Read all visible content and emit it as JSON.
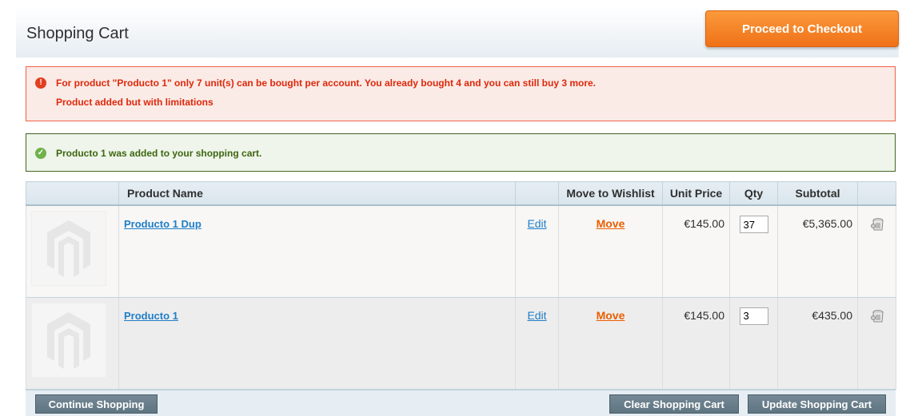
{
  "header": {
    "title": "Shopping Cart",
    "checkout_label": "Proceed to Checkout"
  },
  "messages": {
    "error": {
      "line1": "For product \"Producto 1\" only 7 unit(s) can be bought per account. You already bought 4 and you can still buy 3 more.",
      "line2": "Product added but with limitations"
    },
    "success": {
      "line1": "Producto 1 was added to your shopping cart."
    }
  },
  "table": {
    "headers": {
      "image": "",
      "name": "Product Name",
      "edit": "",
      "wishlist": "Move to Wishlist",
      "unit_price": "Unit Price",
      "qty": "Qty",
      "subtotal": "Subtotal",
      "remove": ""
    },
    "rows": [
      {
        "name": "Producto 1 Dup",
        "edit": "Edit",
        "move": "Move",
        "unit_price": "€145.00",
        "qty": "37",
        "subtotal": "€5,365.00"
      },
      {
        "name": "Producto 1",
        "edit": "Edit",
        "move": "Move",
        "unit_price": "€145.00",
        "qty": "3",
        "subtotal": "€435.00"
      }
    ]
  },
  "buttons": {
    "continue": "Continue Shopping",
    "clear": "Clear Shopping Cart",
    "update": "Update Shopping Cart"
  },
  "icons": {
    "error": "error-icon",
    "success": "success-icon",
    "remove": "trash-icon",
    "placeholder": "product-placeholder-icon"
  },
  "colors": {
    "checkout": "#f07118",
    "error_text": "#df280a",
    "success_text": "#3d6611",
    "link": "#1e7ec8",
    "move": "#eb5e00"
  }
}
